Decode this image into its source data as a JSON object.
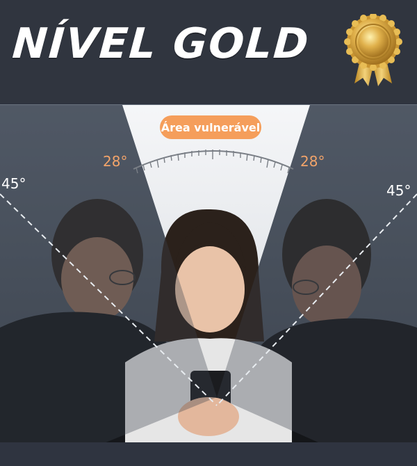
{
  "header": {
    "title": "NÍVEL GOLD",
    "medal_icon": "gold-medal-icon"
  },
  "graphic": {
    "badge_label": "Área vulnerável",
    "angle_left_inner": "28°",
    "angle_right_inner": "28°",
    "angle_left_outer": "45°",
    "angle_right_outer": "45°"
  },
  "colors": {
    "background": "#2f3440",
    "badge": "#f59e5b",
    "angle_accent": "#f2a46a",
    "gold": "#d9a93a"
  }
}
